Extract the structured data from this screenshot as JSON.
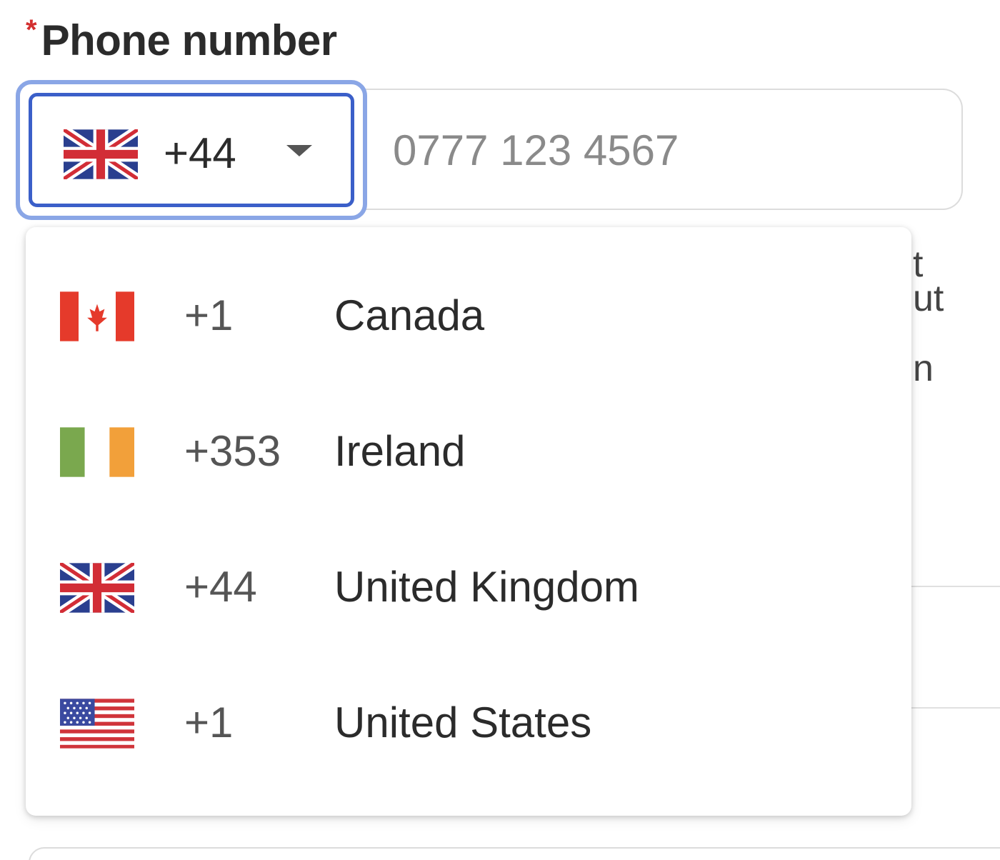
{
  "field": {
    "required_marker": "*",
    "label": "Phone number",
    "selected_country": {
      "code": "+44",
      "flag": "uk-flag-icon"
    },
    "number_placeholder": "0777 123 4567",
    "focus_color": "#3b5fc9"
  },
  "background_fragments": [
    "t",
    "ut",
    "n"
  ],
  "dropdown": {
    "options": [
      {
        "code": "+1",
        "name": "Canada",
        "flag": "canada-flag-icon"
      },
      {
        "code": "+353",
        "name": "Ireland",
        "flag": "ireland-flag-icon"
      },
      {
        "code": "+44",
        "name": "United Kingdom",
        "flag": "uk-flag-icon"
      },
      {
        "code": "+1",
        "name": "United States",
        "flag": "us-flag-icon"
      }
    ]
  }
}
